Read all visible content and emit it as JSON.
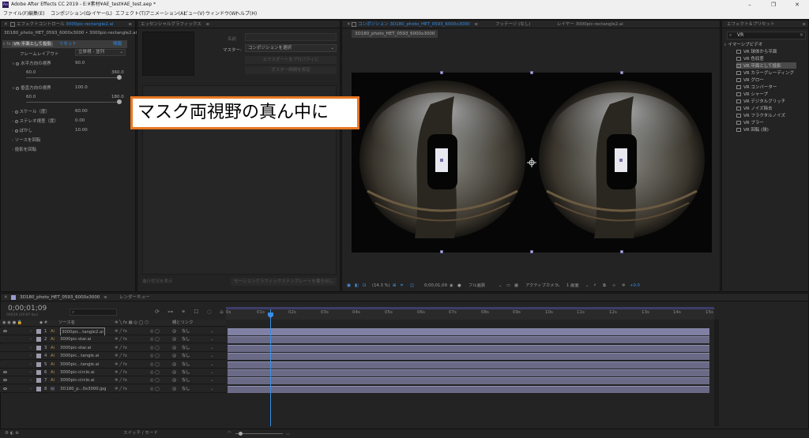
{
  "app": {
    "title": "Adobe After Effects CC 2019 - E:¥素材¥AE_test¥AE_test.aep *",
    "logo": "Ae"
  },
  "menu": [
    "ファイル(F)",
    "編集(E)",
    "コンポジション(C)",
    "レイヤー(L)",
    "エフェクト(T)",
    "アニメーション(A)",
    "ビュー(V)",
    "ウィンドウ(W)",
    "ヘルプ(H)"
  ],
  "effect_controls": {
    "tab_label": "エフェクトコントロール",
    "tab_target": "3000pic-rectangle2.ai",
    "breadcrumb": "3D180_photo_HET_0593_6000x3000 • 3000pic-rectangle2.ai",
    "effect_name": "VR 平面として投影",
    "reset": "リセット",
    "about": "情報",
    "frame_layout_label": "フレームレイアウト",
    "frame_layout_value": "立体視 - 並列",
    "h_fov_label": "水平方向の視界",
    "h_fov_value": "90.0",
    "h_fov_min": "60.0",
    "h_fov_max": "360.0",
    "v_fov_label": "垂直方向の視界",
    "v_fov_value": "100.0",
    "v_fov_min": "60.0",
    "v_fov_max": "180.0",
    "scale_label": "スケール（度）",
    "scale_value": "60.00",
    "stereo_label": "ステレオ視差（度）",
    "stereo_value": "0.00",
    "feather_label": "ぼかし",
    "feather_value": "10.00",
    "rotate_source": "ソースを回転",
    "rotate_projection": "投影を回転"
  },
  "essential_graphics": {
    "tab_label": "エッセンシャルグラフィックス",
    "name_label": "名前",
    "master_label": "マスター:",
    "master_value": "コンポジションを選択",
    "btn_1": "エクスポートをプロパティに",
    "btn_2": "ポスター時間を設定",
    "btn_3": "モーショングラフィックステンプレートを書き出し",
    "btn_4": "モーショングラフィックステンプレートを書き出し",
    "btn_solo": "進行状況を表示"
  },
  "composition": {
    "tab_label": "コンポジション 3D180_photo_HET_0593_6000x3000",
    "footage_tab": "フッテージ (なし)",
    "layer_tab": "レイヤー 3000pic-rectangle2.ai",
    "sub_tab": "3D180_photo_HET_0593_6000x3000",
    "zoom": "(14.3 %)",
    "timecode": "0;00;01;09",
    "resolution": "フル画質",
    "camera": "アクティブカメラ",
    "views": "1 画面",
    "exposure": "+0.0"
  },
  "callout": "マスク両視野の真ん中に",
  "effects_presets": {
    "tab_label": "エフェクト＆プリセット",
    "search_value": "VR",
    "category": "イマーシブビデオ",
    "items": [
      "VR 球体から平面",
      "VR 色収差",
      "VR 平面として投影",
      "VR カラーグレーディング",
      "VR グロー",
      "VR コンバーター",
      "VR シャープ",
      "VR デジタルグリッチ",
      "VR ノイズ除去",
      "VR フラクタルノイズ",
      "VR ブラー",
      "VR 回転 (球)"
    ]
  },
  "timeline": {
    "tab_label": "3D180_photo_HET_0593_6000x3000",
    "render_queue": "レンダーキュー",
    "timecode": "0;00;01;09",
    "timecode_sub": "00039 (29.97 fps)",
    "col_source": "ソース名",
    "col_parent": "親とリンク",
    "ruler": [
      "0s",
      "01s",
      "02s",
      "03s",
      "04s",
      "05s",
      "06s",
      "07s",
      "08s",
      "09s",
      "10s",
      "11s",
      "12s",
      "13s",
      "14s",
      "15s"
    ],
    "layers": [
      {
        "num": "1",
        "name": "3000pic...tangle2.ai",
        "parent": "なし",
        "color": "#b38b5b"
      },
      {
        "num": "2",
        "name": "3000pic-star.ai",
        "parent": "なし",
        "color": "#b38b5b"
      },
      {
        "num": "3",
        "name": "3000pic-star.ai",
        "parent": "なし",
        "color": "#b38b5b"
      },
      {
        "num": "4",
        "name": "3000pic...tangle.ai",
        "parent": "なし",
        "color": "#b38b5b"
      },
      {
        "num": "5",
        "name": "3000pic...tangle.ai",
        "parent": "なし",
        "color": "#b38b5b"
      },
      {
        "num": "6",
        "name": "3000pic-circle.ai",
        "parent": "なし",
        "color": "#b38b5b"
      },
      {
        "num": "7",
        "name": "3000pic-circle.ai",
        "parent": "なし",
        "color": "#b38b5b"
      },
      {
        "num": "8",
        "name": "3D180_p...0x3000.jpg",
        "parent": "なし",
        "color": "#9a9ad0"
      }
    ],
    "switch_mode": "スイッチ / モード"
  },
  "colors": {
    "accent_blue": "#2d8ceb",
    "callout_border": "#e87722",
    "track": "#6a6a86"
  }
}
